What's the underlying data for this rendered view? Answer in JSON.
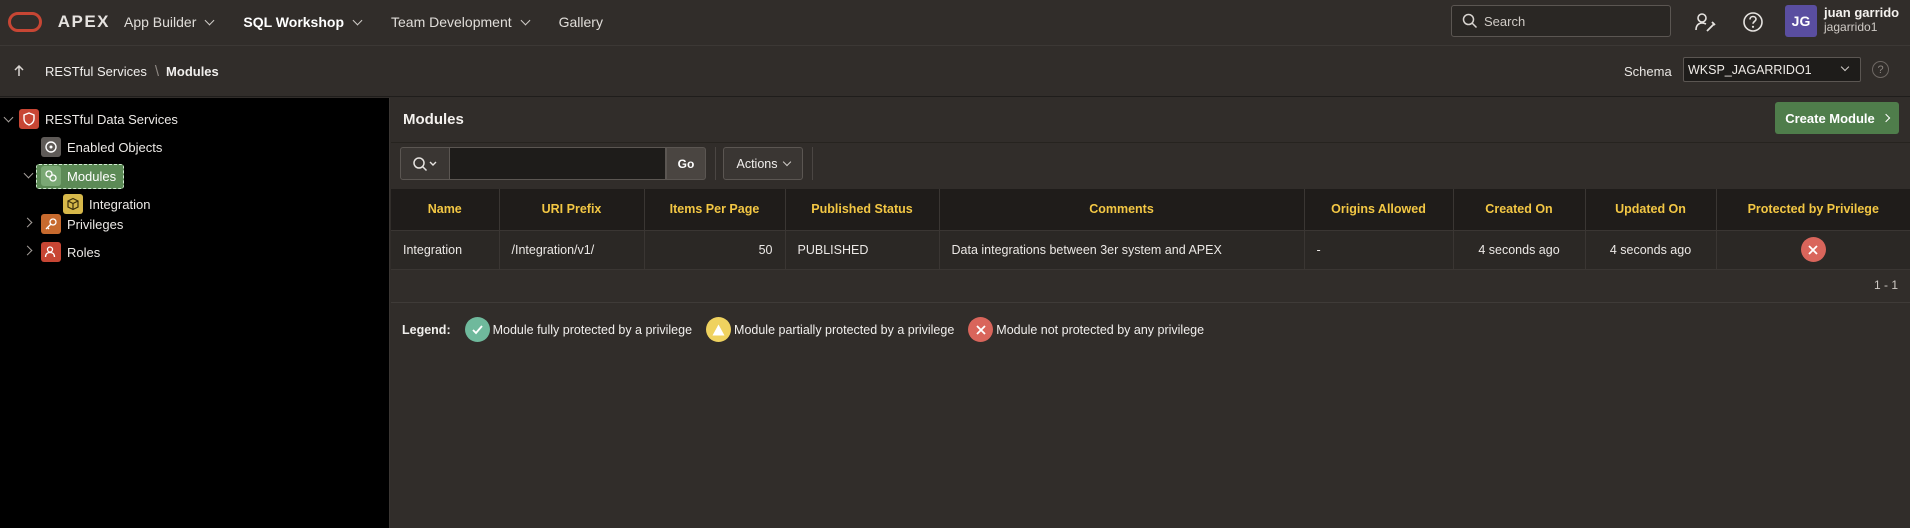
{
  "app": {
    "logo_text": "APEX"
  },
  "nav": [
    {
      "label": "App Builder"
    },
    {
      "label": "SQL Workshop"
    },
    {
      "label": "Team Development"
    },
    {
      "label": "Gallery"
    }
  ],
  "search": {
    "placeholder": "Search"
  },
  "user": {
    "initials": "JG",
    "name": "juan garrido",
    "username": "jagarrido1"
  },
  "breadcrumb": {
    "parent": "RESTful Services",
    "current": "Modules"
  },
  "schema": {
    "label": "Schema",
    "value": "WKSP_JAGARRIDO1"
  },
  "tree": {
    "root": "RESTful Data Services",
    "enabled_objects": "Enabled Objects",
    "modules": "Modules",
    "integration": "Integration",
    "privileges": "Privileges",
    "roles": "Roles"
  },
  "region": {
    "title": "Modules",
    "create_label": "Create Module"
  },
  "toolbar": {
    "go_label": "Go",
    "actions_label": "Actions"
  },
  "table": {
    "columns": [
      "Name",
      "URI Prefix",
      "Items Per Page",
      "Published Status",
      "Comments",
      "Origins Allowed",
      "Created On",
      "Updated On",
      "Protected by Privilege"
    ],
    "rows": [
      {
        "name": "Integration",
        "uri_prefix": "/Integration/v1/",
        "items_per_page": "50",
        "status": "PUBLISHED",
        "comments": "Data integrations between 3er system and APEX",
        "origins": "-",
        "created": "4 seconds ago",
        "updated": "4 seconds ago",
        "protected": "not-protected"
      }
    ]
  },
  "pagination": "1 - 1",
  "legend": {
    "title": "Legend:",
    "full": "Module fully protected by a privilege",
    "partial": "Module partially protected by a privilege",
    "none": "Module not protected by any privilege"
  },
  "colors": {
    "accent_green": "#4f7d4b",
    "header_yellow": "#f3c744",
    "full": "#6fb99c",
    "partial": "#efd25f",
    "none": "#d9655b"
  }
}
